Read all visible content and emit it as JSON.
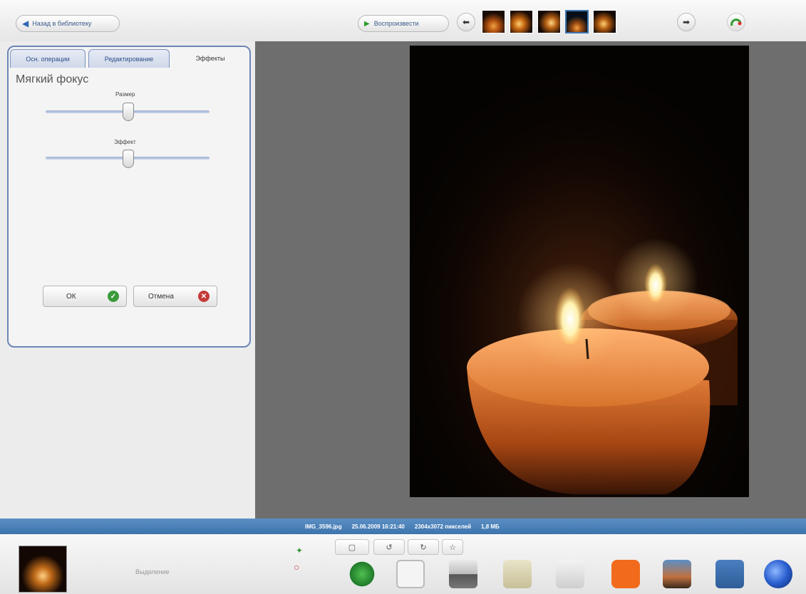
{
  "toolbar": {
    "back_label": "Назад в библиотеку",
    "play_label": "Воспроизвести"
  },
  "editor": {
    "tabs": [
      {
        "label": "Осн. операции"
      },
      {
        "label": "Редактирование"
      },
      {
        "label": "Эффекты"
      }
    ],
    "effect_title": "Мягкий фокус",
    "size_label": "Размер",
    "effect_label": "Эффект",
    "size_value": 0.5,
    "effect_value": 0.5,
    "ok_label": "ОК",
    "cancel_label": "Отмена"
  },
  "statusbar": {
    "filename": "IMG_3596.jpg",
    "datetime": "25.06.2009 16:21:40",
    "dimensions": "2304x3072 пикселей",
    "filesize": "1,8 МБ"
  },
  "tray": {
    "preview_label": "Выделение"
  },
  "colors": {
    "accent": "#3d74ad",
    "panel_border": "#6d86b8",
    "canvas_bg": "#6e6e6e"
  }
}
